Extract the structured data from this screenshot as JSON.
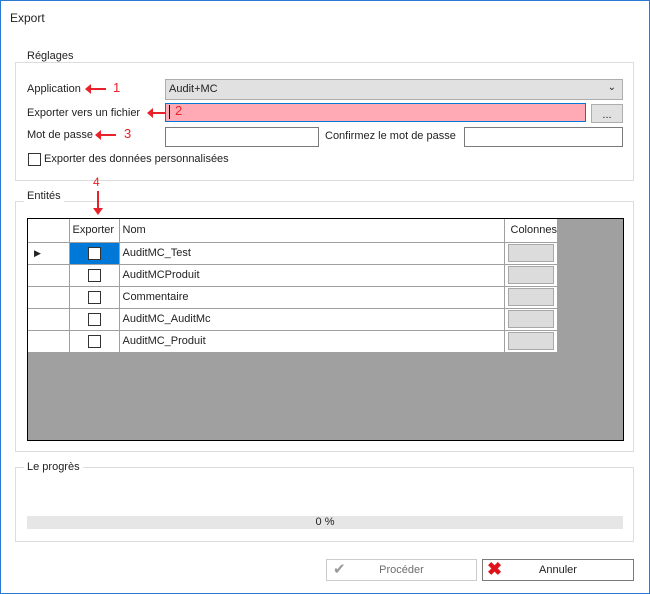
{
  "window": {
    "title": "Export"
  },
  "settings": {
    "group_label": "Réglages",
    "application_label": "Application",
    "application_value": "Audit+MC",
    "export_file_label": "Exporter vers un fichier",
    "export_file_value": "",
    "browse_label": "...",
    "password_label": "Mot de passe",
    "confirm_password_label": "Confirmez le mot de passe",
    "custom_data_label": "Exporter des données personnalisées",
    "custom_data_checked": false
  },
  "annotations": [
    "1",
    "2",
    "3",
    "4"
  ],
  "entities": {
    "group_label": "Entités",
    "columns": [
      "Exporter",
      "Nom",
      "Colonnes"
    ],
    "rows": [
      {
        "export": false,
        "name": "AuditMC_Test",
        "selected": true
      },
      {
        "export": false,
        "name": "AuditMCProduit"
      },
      {
        "export": false,
        "name": "Commentaire"
      },
      {
        "export": false,
        "name": "AuditMC_AuditMc"
      },
      {
        "export": false,
        "name": "AuditMC_Produit"
      }
    ]
  },
  "progress": {
    "group_label": "Le progrès",
    "value_percent": 0,
    "text": "0 %"
  },
  "buttons": {
    "proceed": "Procéder",
    "cancel": "Annuler"
  },
  "colors": {
    "accent": "#0078d7",
    "error_field": "#ffaab4",
    "annotation": "#e8222a"
  }
}
